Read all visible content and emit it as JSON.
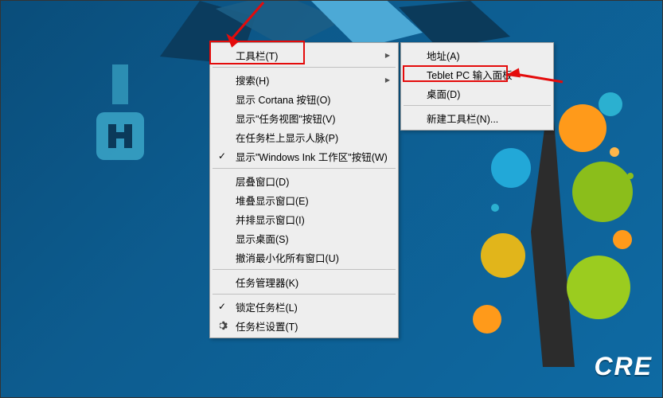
{
  "desktop": {
    "cre_text": "CRE"
  },
  "primary_menu": {
    "group1": [
      {
        "label": "工具栏(T)",
        "has_sub": true,
        "checked": false
      }
    ],
    "group2": [
      {
        "label": "搜索(H)",
        "has_sub": true,
        "checked": false
      },
      {
        "label": "显示 Cortana 按钮(O)",
        "has_sub": false,
        "checked": false
      },
      {
        "label": "显示\"任务视图\"按钮(V)",
        "has_sub": false,
        "checked": false
      },
      {
        "label": "在任务栏上显示人脉(P)",
        "has_sub": false,
        "checked": false
      },
      {
        "label": "显示\"Windows Ink 工作区\"按钮(W)",
        "has_sub": false,
        "checked": true
      }
    ],
    "group3": [
      {
        "label": "层叠窗口(D)",
        "has_sub": false,
        "checked": false
      },
      {
        "label": "堆叠显示窗口(E)",
        "has_sub": false,
        "checked": false
      },
      {
        "label": "并排显示窗口(I)",
        "has_sub": false,
        "checked": false
      },
      {
        "label": "显示桌面(S)",
        "has_sub": false,
        "checked": false
      },
      {
        "label": "撤消最小化所有窗口(U)",
        "has_sub": false,
        "checked": false
      }
    ],
    "group4": [
      {
        "label": "任务管理器(K)",
        "has_sub": false,
        "checked": false
      }
    ],
    "group5": [
      {
        "label": "锁定任务栏(L)",
        "has_sub": false,
        "checked": true
      },
      {
        "label": "任务栏设置(T)",
        "has_sub": false,
        "checked": false,
        "icon": "gear"
      }
    ]
  },
  "sub_menu": {
    "group1": [
      {
        "label": "地址(A)"
      },
      {
        "label": "Teblet PC 输入面板"
      },
      {
        "label": "桌面(D)"
      }
    ],
    "group2": [
      {
        "label": "新建工具栏(N)..."
      }
    ]
  },
  "annotations": {
    "highlight_primary": "工具栏(T)",
    "highlight_sub": "Teblet PC 输入面板"
  }
}
